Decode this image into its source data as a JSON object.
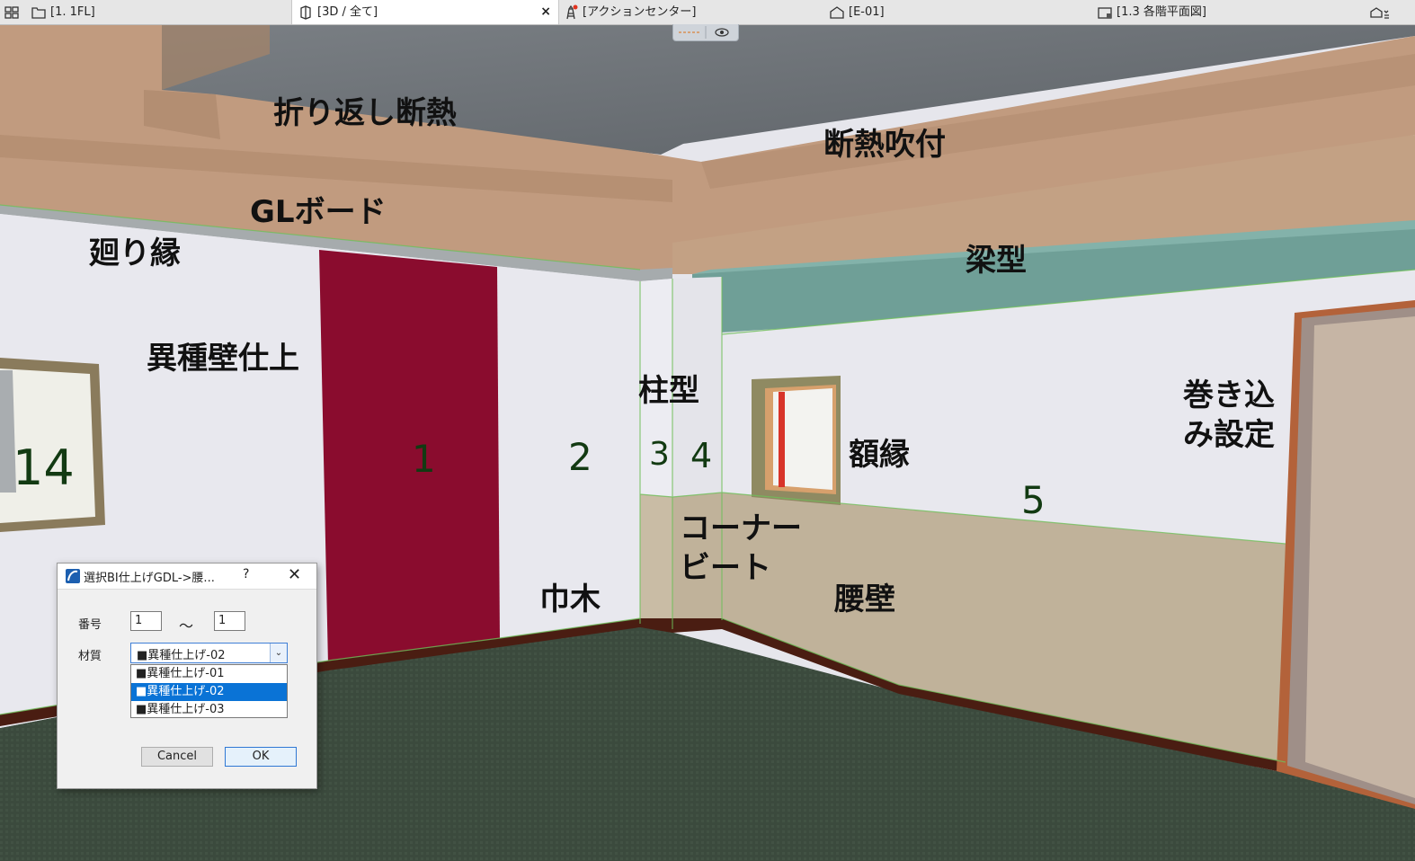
{
  "tabs": [
    {
      "label": "[1. 1FL]",
      "icon": "floor-plan-icon"
    },
    {
      "label": "[3D / 全て]",
      "icon": "3d-view-icon",
      "active": true,
      "close": "×"
    },
    {
      "label": "[アクションセンター]",
      "icon": "action-center-icon"
    },
    {
      "label": "[E-01]",
      "icon": "elevation-icon"
    },
    {
      "label": "[1.3 各階平面図]",
      "icon": "layout-icon"
    }
  ],
  "annotations": {
    "orikaeshi": "折り返し断熱",
    "dannetsu_fukitsuke": "断熱吹付",
    "gl_board": "GLボード",
    "mawaribuchi": "廻り縁",
    "harigata": "梁型",
    "ishu_kabe": "異種壁仕上",
    "hashiragata": "柱型",
    "gakubuchi": "額縁",
    "makikomi_1": "巻き込",
    "makikomi_2": "み設定",
    "corner_1": "コーナー",
    "corner_2": "ビート",
    "habaki": "巾木",
    "koshikabe": "腰壁"
  },
  "wall_numbers": {
    "n14": "14",
    "n1": "1",
    "n2": "2",
    "n3": "3",
    "n4": "4",
    "n5": "5"
  },
  "dialog": {
    "title": "選択BI仕上げGDL->腰...",
    "help": "?",
    "close": "✕",
    "number_label": "番号",
    "number_from": "1",
    "tilde": "～",
    "number_to": "1",
    "material_label": "材質",
    "material_selected": "■異種仕上げ-02",
    "options": [
      "■異種仕上げ-01",
      "■異種仕上げ-02",
      "■異種仕上げ-03"
    ],
    "selected_index": 1,
    "cancel": "Cancel",
    "ok": "OK"
  },
  "colors": {
    "ceiling_wood": "#c19b7f",
    "concrete": "#6e7378",
    "wall": "#e6e6ec",
    "red_panel": "#8a0c2e",
    "beam_teal": "#6f9f97",
    "wainscot": "#c0b29a",
    "floor": "#3b4a3d",
    "baseboard": "#4a1d12"
  }
}
